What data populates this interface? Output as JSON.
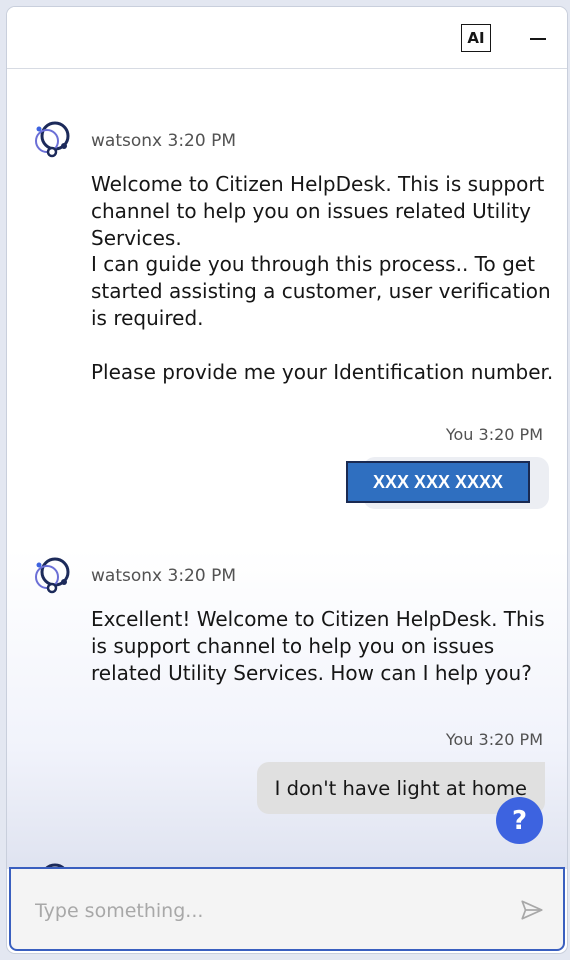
{
  "header": {
    "ai_badge": "AI"
  },
  "messages": [
    {
      "role": "bot",
      "sender": "watsonx",
      "time": "3:20 PM",
      "text": "Welcome to Citizen HelpDesk. This is support channel to help you on issues related Utility Services.\nI can guide you through this process.. To get started assisting a customer, user verification is required.\n\nPlease provide me your Identification number."
    },
    {
      "role": "user",
      "sender": "You",
      "time": "3:20 PM",
      "text": "XXX XXX XXXX"
    },
    {
      "role": "bot",
      "sender": "watsonx",
      "time": "3:20 PM",
      "text": "Excellent! Welcome to Citizen HelpDesk. This is support channel to help you on issues related Utility Services. How can I help you?"
    },
    {
      "role": "user",
      "sender": "You",
      "time": "3:20 PM",
      "text": "I don't have light at home"
    }
  ],
  "help_button": {
    "label": "?"
  },
  "input": {
    "placeholder": "Type something..."
  },
  "colors": {
    "accent": "#3d63e0",
    "id_box": "#2f6fc0",
    "user_bubble": "#e0e0e0"
  }
}
